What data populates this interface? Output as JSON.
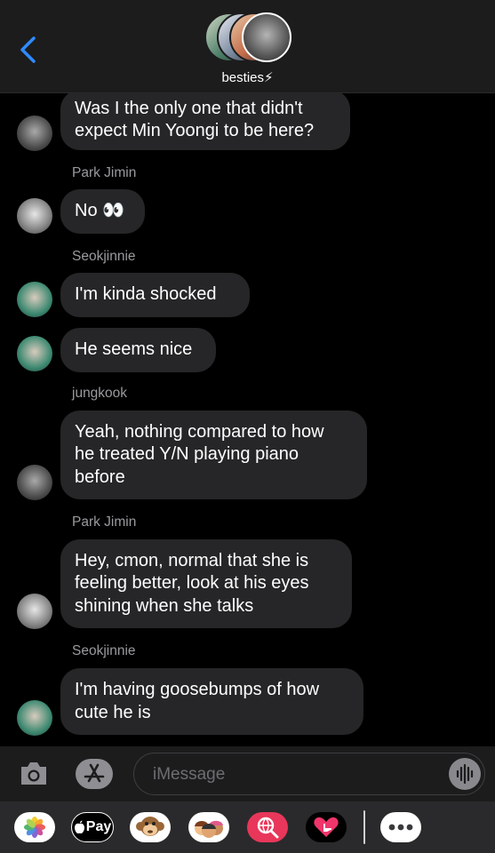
{
  "header": {
    "group_name": "besties⚡"
  },
  "messages": [
    {
      "sender": "",
      "text": "Was I the only one that didn't\nexpect Min Yoongi to be here?"
    },
    {
      "sender": "Park Jimin",
      "text": "No 👀"
    },
    {
      "sender": "Seokjinnie",
      "text": "I'm kinda shocked"
    },
    {
      "sender": "",
      "text": "He seems nice"
    },
    {
      "sender": "jungkook",
      "text": "Yeah, nothing compared to how\nhe treated Y/N playing piano\nbefore"
    },
    {
      "sender": "Park Jimin",
      "text": "Hey, cmon, normal that she is\nfeeling better, look at his eyes\nshining when she talks"
    },
    {
      "sender": "Seokjinnie",
      "text": "I'm having goosebumps of how\ncute he is"
    }
  ],
  "composer": {
    "placeholder": "iMessage"
  },
  "app_drawer": {
    "apple_pay_label": "Pay"
  },
  "colors": {
    "accent": "#2f8bff",
    "bubble": "#262628",
    "header_bg": "#1c1c1d"
  }
}
